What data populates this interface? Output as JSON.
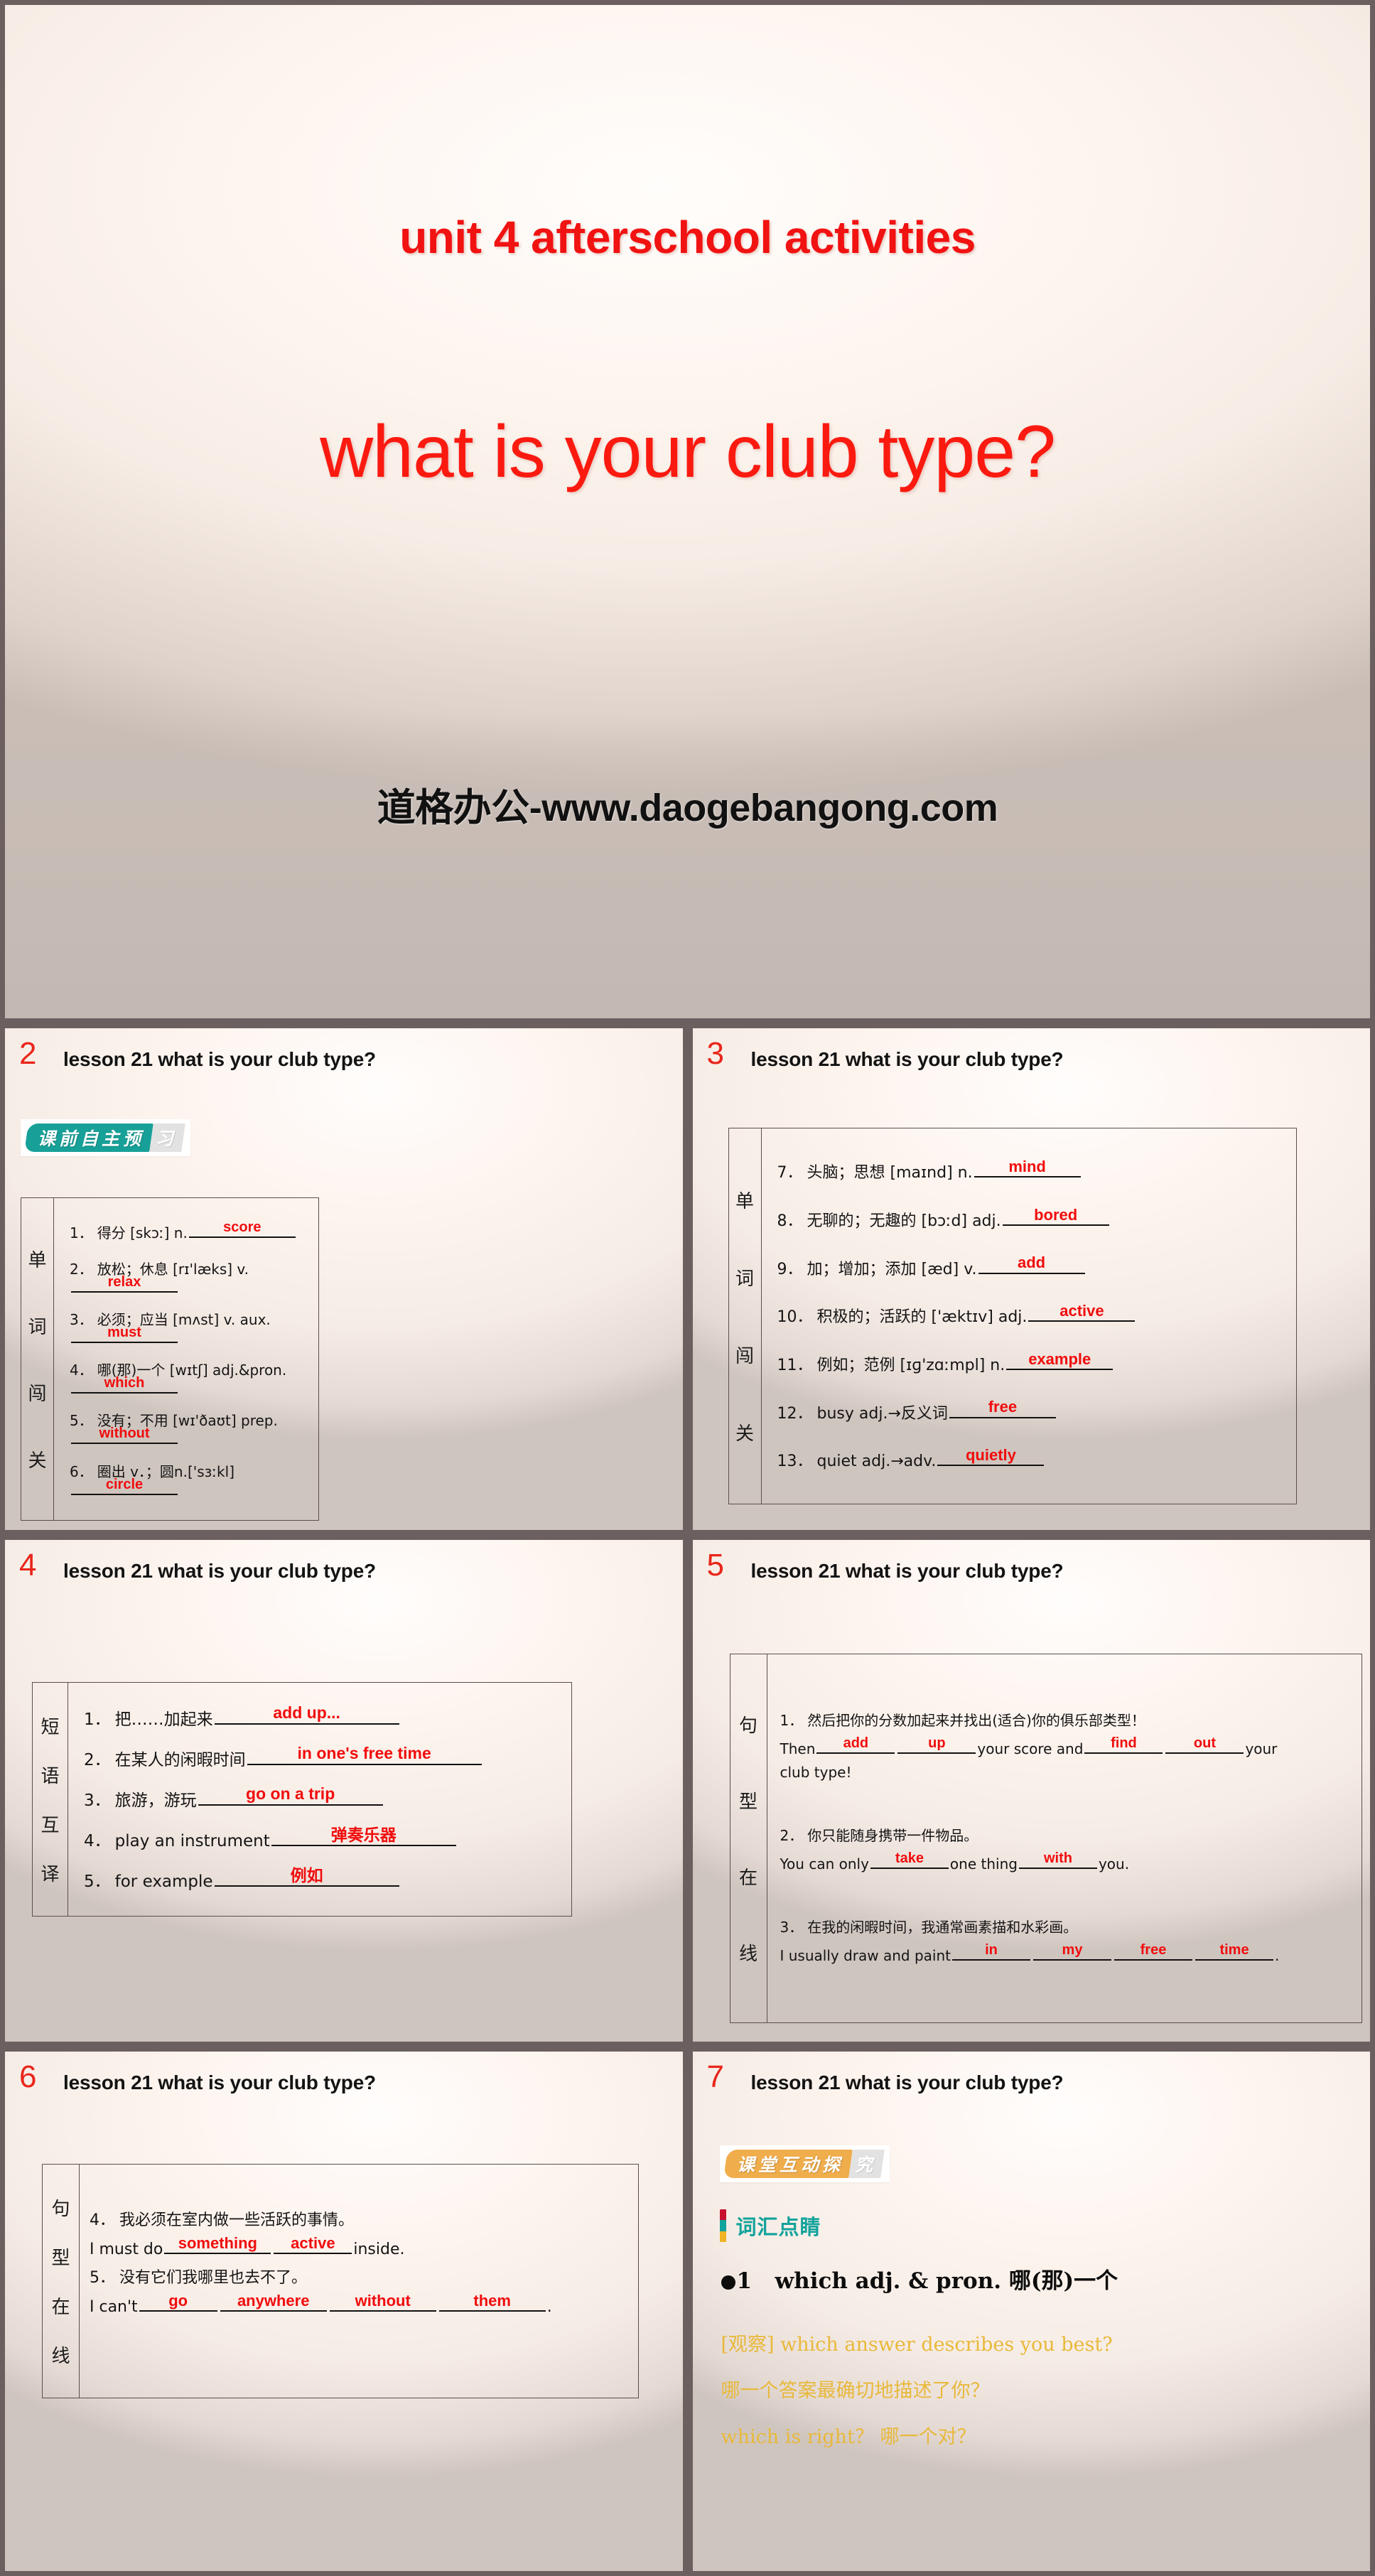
{
  "hero": {
    "unit_title": "unit 4  afterschool activities",
    "main_title": "what is your club type?",
    "watermark": "道格办公-www.daogebangong.com",
    "title_color": "#f11212"
  },
  "slides": [
    {
      "number": "2",
      "header": "lesson 21   what is your club type?",
      "badge": {
        "main": "课前自主预",
        "tail": "习",
        "color": "#17a098"
      },
      "table_label": "单词闯关",
      "rows": [
        {
          "idx": "1．",
          "cn": "得分 [skɔː] n.",
          "answer": "score"
        },
        {
          "idx": "2．",
          "cn": "放松；休息 [rɪ'læks] v.",
          "answer": "relax"
        },
        {
          "idx": "3．",
          "cn": "必须；应当 [mʌst] v. aux.",
          "answer": "must"
        },
        {
          "idx": "4．",
          "cn": "哪(那)一个 [wɪtʃ] adj.&pron.",
          "answer": "which"
        },
        {
          "idx": "5．",
          "cn": "没有；不用 [wɪ'ðaʊt] prep.",
          "answer": "without"
        },
        {
          "idx": "6．",
          "cn": "圈出 v．；圆n.['sɜːkl]",
          "answer": "circle"
        }
      ]
    },
    {
      "number": "3",
      "header": "lesson 21   what is your club type?",
      "table_label": "单词闯关",
      "rows": [
        {
          "idx": "7．",
          "cn": "头脑；思想 [maɪnd] n.",
          "answer": "mind"
        },
        {
          "idx": "8．",
          "cn": "无聊的；无趣的 [bɔːd] adj.",
          "answer": "bored"
        },
        {
          "idx": "9．",
          "cn": "加；增加；添加 [æd] v.",
          "answer": "add"
        },
        {
          "idx": "10．",
          "cn": "积极的；活跃的 ['æktɪv] adj.",
          "answer": "active"
        },
        {
          "idx": "11．",
          "cn": "例如；范例 [ɪɡ'zɑːmpl] n.",
          "answer": "example"
        },
        {
          "idx": "12．",
          "cn": "busy adj.→反义词",
          "answer": "free"
        },
        {
          "idx": "13．",
          "cn": "quiet adj.→adv.",
          "answer": "quietly"
        }
      ]
    },
    {
      "number": "4",
      "header": "lesson 21   what is your club type?",
      "table_label": "短语互译",
      "rows": [
        {
          "idx": "1．",
          "cn": "把……加起来",
          "answer": "add up..."
        },
        {
          "idx": "2．",
          "cn": "在某人的闲暇时间",
          "answer": "in one's free time"
        },
        {
          "idx": "3．",
          "cn": "旅游，游玩",
          "answer": "go on a trip"
        },
        {
          "idx": "4．",
          "cn": "play an instrument",
          "answer": "弹奏乐器"
        },
        {
          "idx": "5．",
          "cn": "for example",
          "answer": "例如"
        }
      ]
    },
    {
      "number": "5",
      "header": "lesson 21   what is your club type?",
      "table_label": "句型在线",
      "items": [
        {
          "idx": "1．",
          "cn": "然后把你的分数加起来并找出(适合)你的俱乐部类型！",
          "en_parts": [
            "Then ",
            " ",
            " your score and ",
            " ",
            " your"
          ],
          "answers": [
            "add",
            "up",
            "find",
            "out"
          ],
          "tail": "club type!"
        },
        {
          "idx": "2．",
          "cn": "你只能随身携带一件物品。",
          "en_parts": [
            " You can only ",
            " one thing ",
            " you."
          ],
          "answers": [
            "take",
            "with"
          ]
        },
        {
          "idx": "3．",
          "cn": "在我的闲暇时间，我通常画素描和水彩画。",
          "en_parts": [
            "I usually draw and paint ",
            " ",
            " ",
            " ",
            "."
          ],
          "answers": [
            "in",
            "my",
            "free",
            "time"
          ]
        }
      ]
    },
    {
      "number": "6",
      "header": "lesson 21   what is your club type?",
      "table_label": "句型在线",
      "items": [
        {
          "idx": "4．",
          "cn": "我必须在室内做一些活跃的事情。",
          "en_lead": "I must do ",
          "answers": [
            "something",
            "active"
          ],
          "en_tail": " inside."
        },
        {
          "idx": "5．",
          "cn": "没有它们我哪里也去不了。",
          "en_lead": "I can't ",
          "answers": [
            "go",
            "anywhere",
            "without",
            "them"
          ],
          "en_tail": "."
        }
      ]
    },
    {
      "number": "7",
      "header": "lesson 21   what is your club type?",
      "badge": {
        "main": "课堂互动探",
        "tail": "究",
        "color": "#f0ad4b"
      },
      "section_title": "词汇点睛",
      "section_bar_colors": [
        "#c8102e",
        "#12a39b",
        "#f0b323"
      ],
      "point_number": "1",
      "point_text": "which adj. & pron. 哪(那)一个",
      "observe_lines": [
        "[观察] which answer describes  you best?",
        "哪一个答案最确切地描述了你？",
        "which is right？ 哪一个对？"
      ]
    }
  ]
}
